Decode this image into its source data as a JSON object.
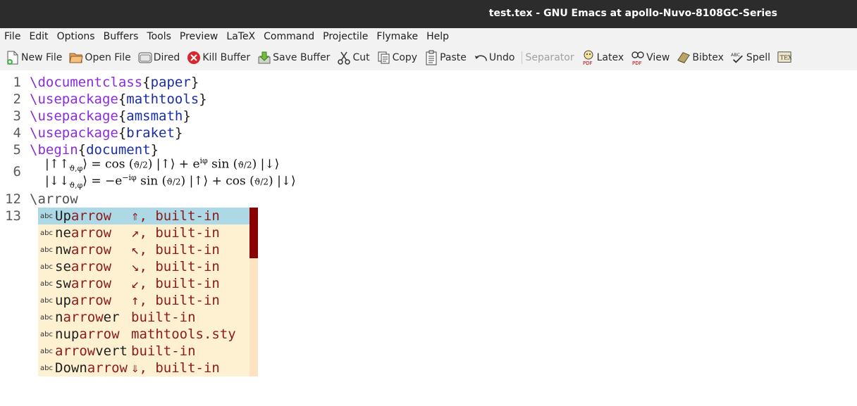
{
  "window": {
    "title": "test.tex - GNU Emacs at apollo-Nuvo-8108GC-Series"
  },
  "menubar": [
    "File",
    "Edit",
    "Options",
    "Buffers",
    "Tools",
    "Preview",
    "LaTeX",
    "Command",
    "Projectile",
    "Flymake",
    "Help"
  ],
  "toolbar": {
    "new_file": "New File",
    "open_file": "Open File",
    "dired": "Dired",
    "kill_buffer": "Kill Buffer",
    "save_buffer": "Save Buffer",
    "cut": "Cut",
    "copy": "Copy",
    "paste": "Paste",
    "undo": "Undo",
    "separator": "Separator",
    "latex": "Latex",
    "view": "View",
    "bibtex": "Bibtex",
    "spell": "Spell"
  },
  "editor": {
    "lines": [
      {
        "num": "1",
        "cmd": "\\documentclass",
        "arg": "paper"
      },
      {
        "num": "2",
        "cmd": "\\usepackage",
        "arg": "mathtools"
      },
      {
        "num": "3",
        "cmd": "\\usepackage",
        "arg": "amsmath"
      },
      {
        "num": "4",
        "cmd": "\\usepackage",
        "arg": "braket"
      },
      {
        "num": "5",
        "cmd": "\\begin",
        "arg": "document"
      },
      {
        "num": "6"
      },
      {
        "num": "12",
        "text": "\\arrow"
      },
      {
        "num": "13"
      }
    ],
    "math_line1": "|↑↑ϑ,φ⟩ = cos (ϑ/2) |↑⟩ + e^{iφ} sin (ϑ/2) |↓⟩",
    "math_line2": "|↓↓ϑ,φ⟩ = −e^{−iφ} sin (ϑ/2) |↑⟩ + cos (ϑ/2) |↓⟩"
  },
  "completion": {
    "icon_label": "abc",
    "items": [
      {
        "pre": "Up",
        "match": "arrow",
        "post": "",
        "annotation": "⇑, built-in",
        "selected": true
      },
      {
        "pre": "ne",
        "match": "arrow",
        "post": "",
        "annotation": "↗, built-in"
      },
      {
        "pre": "nw",
        "match": "arrow",
        "post": "",
        "annotation": "↖, built-in"
      },
      {
        "pre": "se",
        "match": "arrow",
        "post": "",
        "annotation": "↘, built-in"
      },
      {
        "pre": "sw",
        "match": "arrow",
        "post": "",
        "annotation": "↙, built-in"
      },
      {
        "pre": "up",
        "match": "arrow",
        "post": "",
        "annotation": "↑, built-in"
      },
      {
        "pre": "n",
        "match": "arrow",
        "post": "er",
        "annotation": "built-in"
      },
      {
        "pre": "nup",
        "match": "arrow",
        "post": "",
        "annotation": "mathtools.sty"
      },
      {
        "pre": "",
        "match": "arrow",
        "post": "vert",
        "annotation": "built-in"
      },
      {
        "pre": "Down",
        "match": "arrow",
        "post": "",
        "annotation": "⇓, built-in"
      }
    ]
  }
}
